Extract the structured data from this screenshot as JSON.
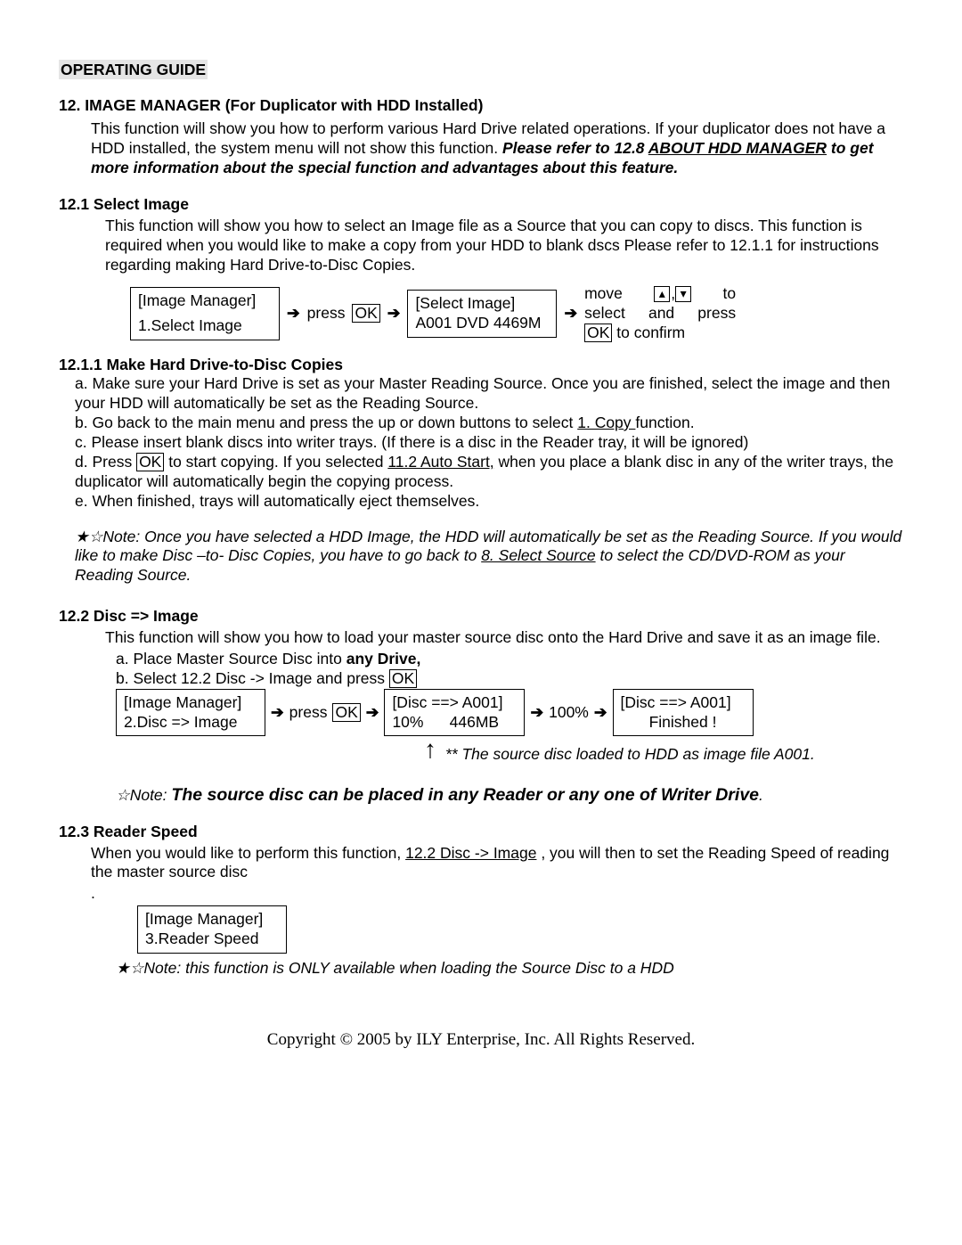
{
  "header": "OPERATING GUIDE",
  "s12": {
    "title_num": "12.",
    "title_rest": "IMAGE MANAGER  (For Duplicator with HDD Installed)",
    "p1": "This function will show you how to perform various Hard Drive related operations. If your duplicator does not have a HDD installed, the system menu will not show this function. ",
    "p1b": "Please refer to 12.8 ",
    "p1c": "ABOUT HDD MANAGER",
    "p1d": " to get more information about the special function and advantages about this feature."
  },
  "s121": {
    "t": "12.1 Select Image",
    "p": "This function will show you how to select an Image file as a Source that you can copy to discs. This function is required when you would like to make a copy from your HDD to blank dscs Please refer to 12.1.1 for instructions regarding making Hard Drive-to-Disc Copies.",
    "box1a": "[Image Manager]",
    "box1b": "1.Select Image",
    "press": "press",
    "ok": "OK",
    "box2a": "[Select Image]",
    "box2b": "A001 DVD 4469M",
    "r1a": "move",
    "r1b": "to",
    "r2": "select and press",
    "r3": " to confirm"
  },
  "s1211": {
    "t": "12.1.1 Make Hard Drive-to-Disc Copies",
    "a": "a. Make sure your Hard Drive is set as your Master Reading Source. Once you are finished",
    "a2": " select the image and then your HDD will automatically be set as the Reading Source.",
    "b1": "b. Go back to the main menu and press the up or down buttons to select ",
    "b2": "1. Copy ",
    "b3": " function.",
    "c": "c. Please insert blank discs into writer trays. (If there is a disc in the Reader tray, it will be ignored)",
    "d1": "d.   Press ",
    "d2": " to start copying.  If you selected ",
    "d3": "11.2 Auto Start,",
    "d4": " when you place a blank disc in any of the writer trays, the duplicator will automatically begin the copying process.",
    "e": "e. When finished, trays will automatically eject themselves.",
    "note1": "Note: Once you have selected a HDD Image, the HDD will automatically be set as the Reading Source. If you would like to make Disc –to- Disc Copies, you have to go back to ",
    "note2": "8. Select Source",
    "note3": " to select the CD/DVD-ROM  as your Reading Source."
  },
  "s122": {
    "t": "12.2  Disc => Image",
    "p": "This function will show you how to load your master source disc onto the Hard Drive and save it as an image file.",
    "a1": "a. Place Master Source Disc into ",
    "a2": "any Drive,",
    "b1": "b. Select 12.2 Disc -> Image and press ",
    "box1a": "[Image Manager]",
    "box1b": "2.Disc => Image",
    "press": "press",
    "ok": "OK",
    "box2a": "[Disc ==> A001]",
    "box2b": "10%      446MB",
    "hun": "100%",
    "box3a": "[Disc ==> A001]",
    "box3b": "Finished !",
    "note_arrow": "** The source disc loaded to HDD as image file A001.",
    "big_note_pre": "Note: ",
    "big_note": "The source disc can be placed in any Reader or any one of Writer Drive",
    "period": "."
  },
  "s123": {
    "t": "12.3 Reader Speed",
    "p1": "When you would like to perform this function, ",
    "p2": "12.2 Disc -> Image",
    "p3": " , you will then to set the Reading Speed of reading the master source disc",
    "dot": ".",
    "box1a": "[Image Manager]",
    "box1b": "3.Reader Speed",
    "note": "Note: this function is ONLY available when loading the Source Disc to a HDD"
  },
  "footer": "Copyright © 2005 by ILY Enterprise, Inc. All Rights Reserved."
}
